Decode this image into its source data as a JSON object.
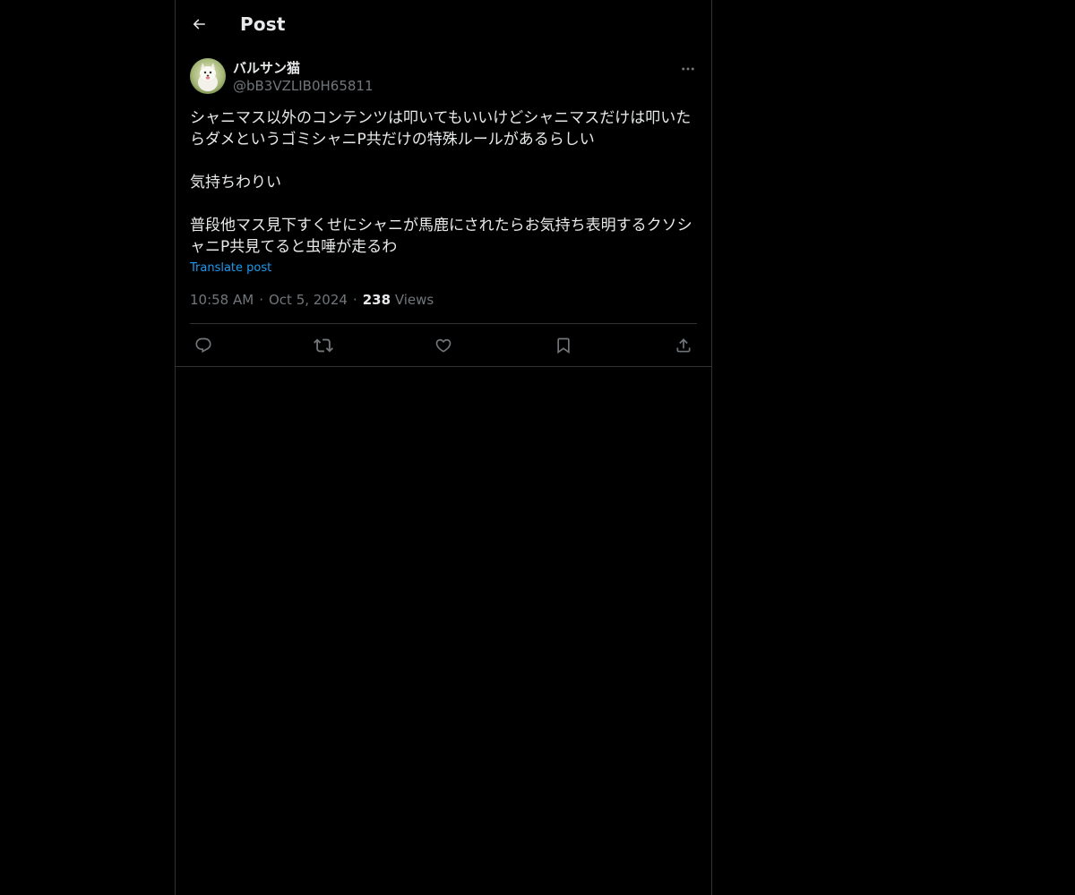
{
  "header": {
    "title": "Post"
  },
  "post": {
    "author": {
      "display_name": "バルサン猫",
      "handle": "@bB3VZLIB0H65811"
    },
    "text": "シャニマス以外のコンテンツは叩いてもいいけどシャニマスだけは叩いたらダメというゴミシャニP共だけの特殊ルールがあるらしい\n\n気持ちわりい\n\n普段他マス見下すくせにシャニが馬鹿にされたらお気持ち表明するクソシャニP共見てると虫唾が走るわ",
    "translate_label": "Translate post",
    "time": "10:58 AM",
    "date": "Oct 5, 2024",
    "separator": "·",
    "views_count": "238",
    "views_label": "Views"
  },
  "actions": {
    "reply_icon": "reply-icon",
    "repost_icon": "repost-icon",
    "like_icon": "like-icon",
    "bookmark_icon": "bookmark-icon",
    "share_icon": "share-icon"
  },
  "colors": {
    "background": "#000000",
    "text": "#e7e9ea",
    "muted": "#71767b",
    "border": "#2f3336",
    "link": "#1d9bf0"
  }
}
